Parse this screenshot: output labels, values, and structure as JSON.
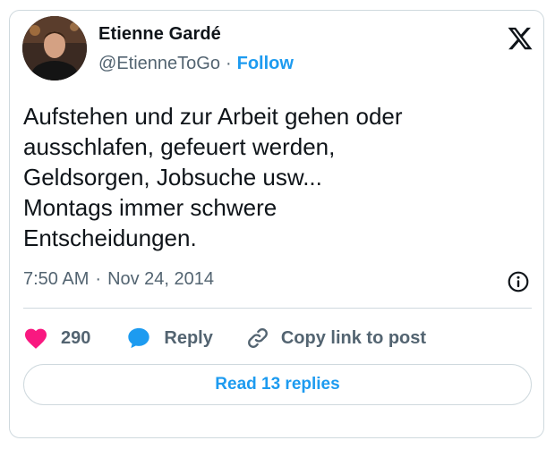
{
  "author": {
    "name": "Etienne Gardé",
    "handle": "@EtienneToGo",
    "separator": "·",
    "follow_label": "Follow"
  },
  "tweet": {
    "text": "Aufstehen und zur Arbeit gehen oder\nausschlafen, gefeuert werden,\nGeldsorgen, Jobsuche usw...\nMontags immer schwere\nEntscheidungen.",
    "time": "7:50 AM",
    "meta_separator": "·",
    "date": "Nov 24, 2014"
  },
  "actions": {
    "like_count": "290",
    "reply_label": "Reply",
    "copy_label": "Copy link to post"
  },
  "footer": {
    "read_replies_label": "Read 13 replies"
  },
  "icons": {
    "brand": "x-logo-icon",
    "info": "info-icon",
    "like": "heart-icon",
    "reply": "speech-bubble-icon",
    "copy": "link-icon"
  },
  "colors": {
    "accent": "#1d9bf0",
    "like": "#f91880",
    "secondary_text": "#536471",
    "border": "#cfd9de"
  }
}
